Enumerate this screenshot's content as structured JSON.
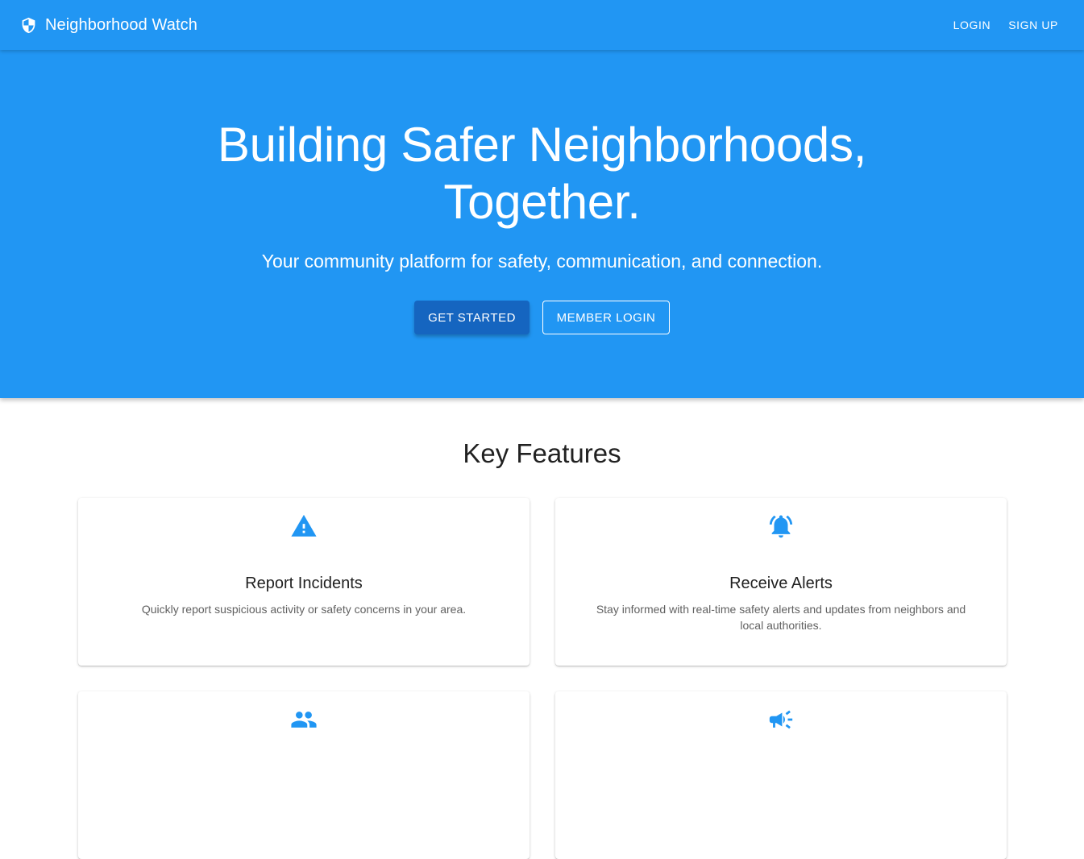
{
  "app_bar": {
    "brand_icon": "shield-icon",
    "title": "Neighborhood Watch",
    "nav": {
      "login_label": "LOGIN",
      "signup_label": "SIGN UP"
    }
  },
  "hero": {
    "title_line1": "Building Safer Neighborhoods,",
    "title_line2": "Together.",
    "subtitle": "Your community platform for safety, communication, and connection.",
    "primary_button": "GET STARTED",
    "secondary_button": "MEMBER LOGIN"
  },
  "features": {
    "title": "Key Features",
    "items": [
      {
        "icon": "warning-triangle-icon",
        "title": "Report Incidents",
        "description": "Quickly report suspicious activity or safety concerns in your area."
      },
      {
        "icon": "alarm-bell-icon",
        "title": "Receive Alerts",
        "description": "Stay informed with real-time safety alerts and updates from neighbors and local authorities."
      },
      {
        "icon": "group-people-icon"
      },
      {
        "icon": "megaphone-icon"
      }
    ]
  },
  "colors": {
    "primary": "#2196f3",
    "primary_dark": "#1565c0",
    "text_dark": "#212121",
    "text_muted": "#616161"
  }
}
